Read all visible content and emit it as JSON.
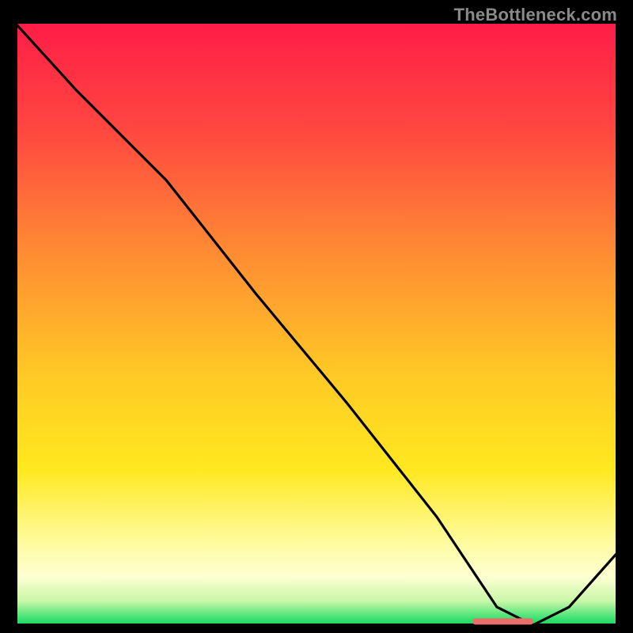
{
  "watermark": "TheBottleneck.com",
  "chart_data": {
    "type": "line",
    "title": "",
    "xlabel": "",
    "ylabel": "",
    "xlim": [
      0,
      100
    ],
    "ylim": [
      0,
      100
    ],
    "grid": false,
    "legend": false,
    "notes": "Background is a vertical gradient from red (top) through orange/yellow to pale yellow and a thin green band at the very bottom. A single black series overlays it. A short coral-red horizontal marker sits near the bottom around x≈76–86.",
    "series": [
      {
        "name": "curve",
        "x": [
          0,
          10,
          25,
          40,
          55,
          70,
          80,
          86,
          92,
          100
        ],
        "y": [
          100,
          89,
          74,
          55,
          37,
          18,
          3,
          0,
          3,
          12
        ]
      }
    ],
    "marker": {
      "x_start": 76,
      "x_end": 86,
      "y": 0.6,
      "color": "#e9706a"
    },
    "gradient_stops": [
      {
        "pct": 0,
        "color": "#ff1d47"
      },
      {
        "pct": 18,
        "color": "#ff4840"
      },
      {
        "pct": 38,
        "color": "#ff8b33"
      },
      {
        "pct": 58,
        "color": "#ffc825"
      },
      {
        "pct": 74,
        "color": "#ffe81f"
      },
      {
        "pct": 86,
        "color": "#fffb9c"
      },
      {
        "pct": 92,
        "color": "#fdffd2"
      },
      {
        "pct": 96,
        "color": "#c9f7a8"
      },
      {
        "pct": 99,
        "color": "#36e06f"
      },
      {
        "pct": 100,
        "color": "#1bd65f"
      }
    ]
  }
}
